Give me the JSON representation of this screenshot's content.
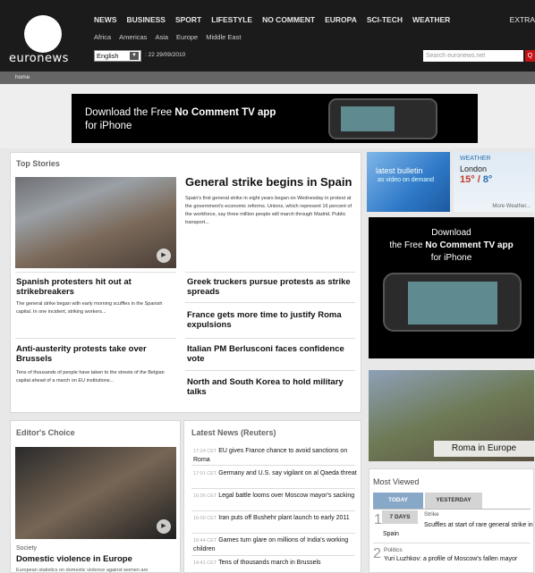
{
  "brand": {
    "name": "euronews"
  },
  "nav": {
    "items": [
      "NEWS",
      "BUSINESS",
      "SPORT",
      "LIFESTYLE",
      "NO COMMENT",
      "EUROPA",
      "SCI-TECH",
      "WEATHER"
    ],
    "extra": "EXTRA",
    "sub": [
      "Africa",
      "Americas",
      "Asia",
      "Europe",
      "Middle East"
    ]
  },
  "header": {
    "language": "English",
    "datetime": ": 22 29/09/2010",
    "search_placeholder": "Search euronews.net"
  },
  "breadcrumb": "home",
  "banner": {
    "line1": "Download the Free ",
    "bold": "No Comment TV app",
    "line2": "for iPhone"
  },
  "top_stories": {
    "title": "Top Stories",
    "main": {
      "headline": "General strike begins in Spain",
      "text": "Spain's first general strike in eight years began on Wednesday in protest at the government's economic reforms. Unions, which represent 16 percent of the workforce, say three million people will march through Madrid. Public transport..."
    },
    "left": [
      {
        "headline": "Spanish protesters hit out at strikebreakers",
        "text": "The general strike began with early morning scuffles in the Spanish capital. In one incident, striking workers..."
      },
      {
        "headline": "Anti-austerity protests take over Brussels",
        "text": "Tens of thousands of people have taken to the streets of the Belgian capital ahead of a march on EU institutions..."
      }
    ],
    "right": [
      "Greek truckers pursue protests as strike spreads",
      "France gets more time to justify Roma expulsions",
      "Italian PM Berlusconi faces confidence vote",
      "North and South Korea to hold military talks"
    ]
  },
  "weather": {
    "bulletin_a": "latest bulletin",
    "bulletin_b": "as video on demand",
    "label": "WEATHER",
    "city": "London",
    "temp_hi": "15°",
    "temp_lo": "8°",
    "more": "More Weather..."
  },
  "side_ad": {
    "line1": "Download",
    "line2a": "the Free ",
    "line2b": "No Comment TV app",
    "line3": "for iPhone"
  },
  "roma": {
    "label": "Roma in Europe"
  },
  "editors_choice": {
    "title": "Editor's Choice",
    "category": "Society",
    "headline": "Domestic violence in Europe",
    "teaser": "European statistics on domestic violence against women are"
  },
  "latest_news": {
    "title": "Latest News (Reuters)",
    "items": [
      {
        "time": "17:24 CET",
        "text": "EU gives France chance to avoid sanctions on Roma"
      },
      {
        "time": "17:01 CET",
        "text": "Germany and U.S. say vigilant on al Qaeda threat"
      },
      {
        "time": "16:06 CET",
        "text": "Legal battle looms over Moscow mayor's sacking"
      },
      {
        "time": "16:00 CET",
        "text": "Iran puts off Bushehr plant launch to early 2011"
      },
      {
        "time": "15:44 CET",
        "text": "Games turn glare on millions of India's working children"
      },
      {
        "time": "14:41 CET",
        "text": "Tens of thousands march in Brussels"
      }
    ]
  },
  "most_viewed": {
    "title": "Most Viewed",
    "tabs": [
      "TODAY",
      "YESTERDAY"
    ],
    "period": "7 DAYS",
    "items": [
      {
        "num": "1",
        "cat": "Strike",
        "text": "Scuffles at start of rare general strike in Spain"
      },
      {
        "num": "2",
        "cat": "Politics",
        "text": "Yuri Luzhkov: a profile of Moscow's fallen mayor"
      }
    ]
  }
}
